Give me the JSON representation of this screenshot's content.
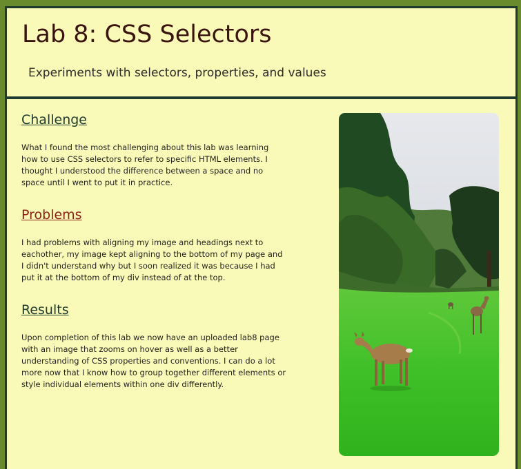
{
  "header": {
    "title": "Lab 8: CSS Selectors",
    "subtitle": "Experiments with selectors, properties, and values"
  },
  "sections": [
    {
      "heading": "Challenge",
      "body": "What I found the most challenging about this lab was learning how to use CSS selectors to refer to specific HTML elements. I thought I understood the difference between a space and no space until I went to put it in practice."
    },
    {
      "heading": "Problems",
      "body": "I had problems with aligning my image and headings next to eachother, my image kept aligning to the bottom of my page and I didn't understand why but I soon realized it was because I had put it at the bottom of my div instead of at the top."
    },
    {
      "heading": "Results",
      "body": "Upon completion of this lab we now have an uploaded lab8 page with an image that zooms on hover as well as a better understanding of CSS properties and conventions. I can do a lot more now that I know how to group together different elements or style individual elements within one div differently."
    }
  ],
  "colors": {
    "page_background": "#6a8a2e",
    "panel_background": "#fafab8",
    "border": "#1f3a2e",
    "title_text": "#3a140f",
    "problems_heading": "#8a1f12"
  },
  "image": {
    "subject": "deer-on-grass-photo"
  }
}
